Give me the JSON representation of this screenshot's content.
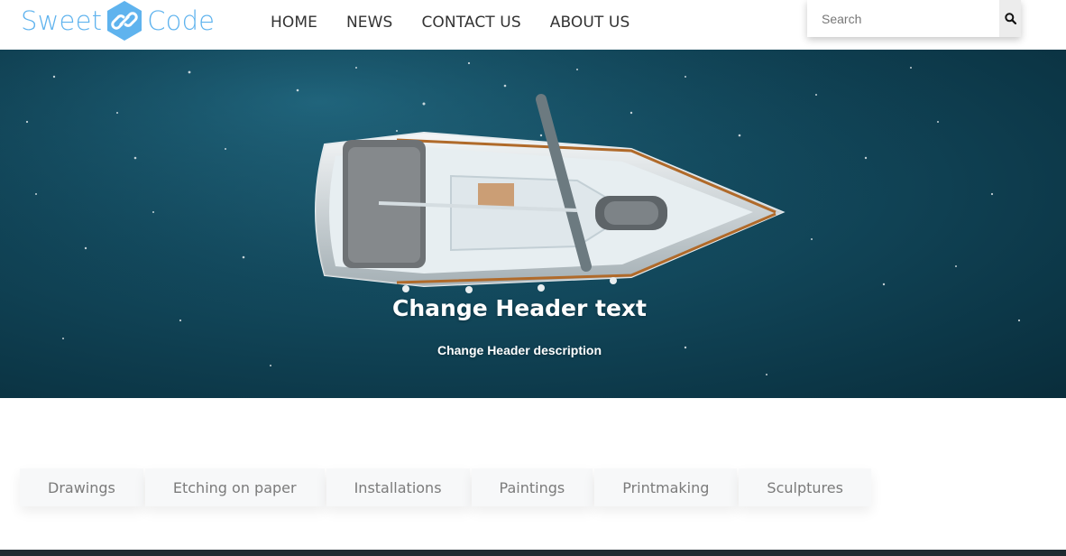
{
  "logo": {
    "left_text": "Sweet",
    "right_text": "Code",
    "icon": "link-icon",
    "brand_color": "#5fb3ee"
  },
  "nav": {
    "items": [
      "HOME",
      "NEWS",
      "CONTACT US",
      "ABOUT US"
    ]
  },
  "search": {
    "placeholder": "Search",
    "icon": "search-icon"
  },
  "hero": {
    "title": "Change Header text",
    "description": "Change Header description"
  },
  "categories": [
    "Drawings",
    "Etching on paper",
    "Installations",
    "Paintings",
    "Printmaking",
    "Sculptures"
  ]
}
